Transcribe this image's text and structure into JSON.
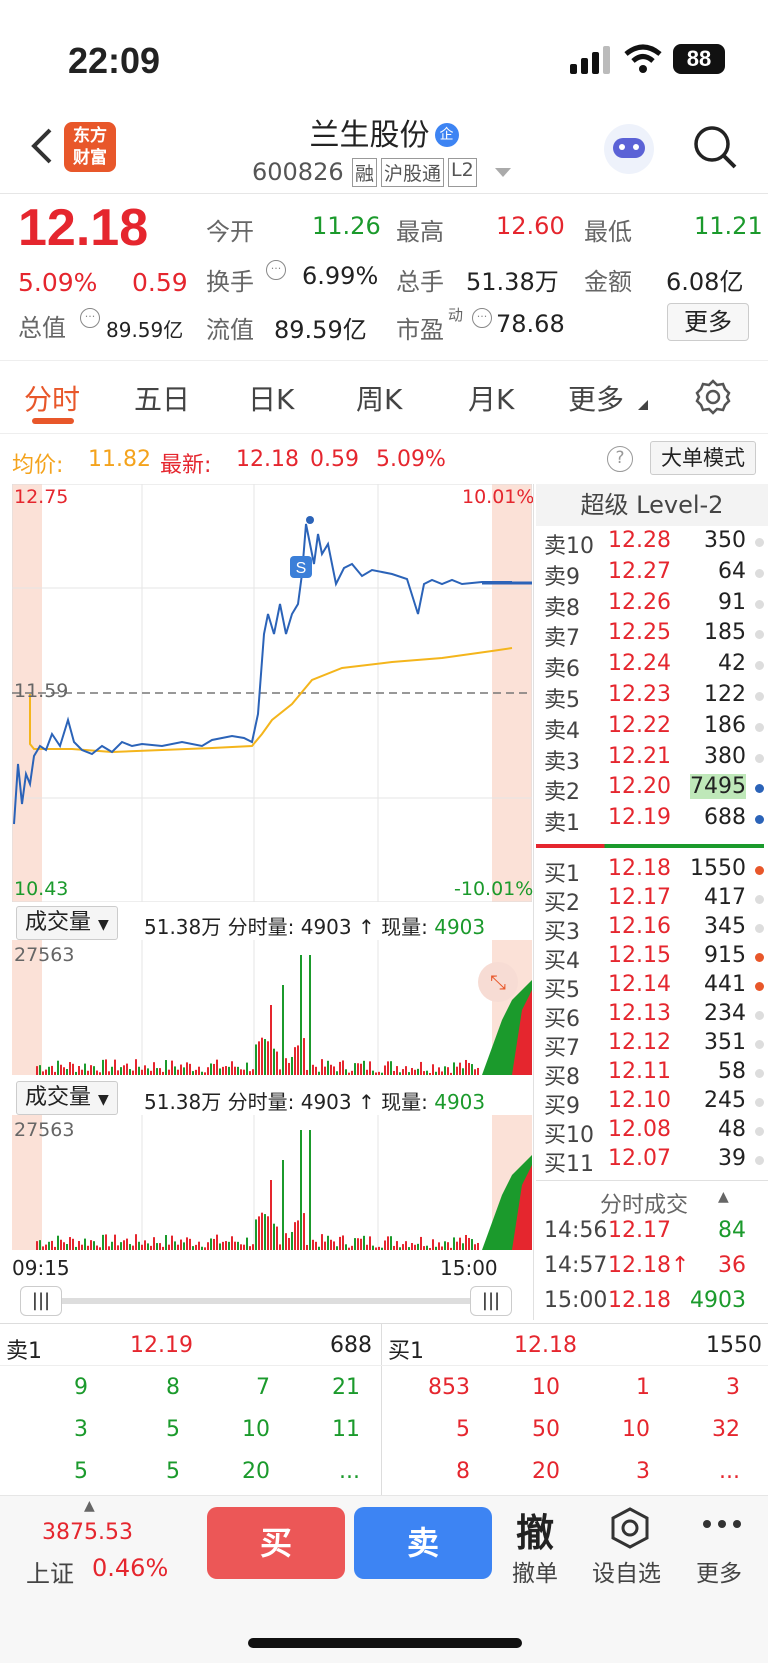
{
  "status": {
    "time": "22:09",
    "battery": "88"
  },
  "header": {
    "name": "兰生股份",
    "badge": "企",
    "code": "600826",
    "tags": [
      "融",
      "沪股通",
      "L2"
    ]
  },
  "quote": {
    "price": "12.18",
    "pct": "5.09%",
    "chg": "0.59",
    "total_label": "总值",
    "total_value": "89.59亿",
    "open_label": "今开",
    "open": "11.26",
    "high_label": "最高",
    "high": "12.60",
    "low_label": "最低",
    "low": "11.21",
    "turn_label": "换手",
    "turn": "6.99%",
    "vol_label": "总手",
    "vol": "51.38万",
    "amt_label": "金额",
    "amt": "6.08亿",
    "float_label": "流值",
    "float": "89.59亿",
    "pe_label": "市盈",
    "pe_sup": "动",
    "pe": "78.68",
    "more": "更多"
  },
  "tabs": [
    "分时",
    "五日",
    "日K",
    "周K",
    "月K",
    "更多"
  ],
  "infobar": {
    "avg_label": "均价:",
    "avg": "11.82",
    "last_label": "最新:",
    "last": "12.18",
    "chg": "0.59",
    "pct": "5.09%",
    "mode": "大单模式"
  },
  "chart": {
    "top_price": "12.75",
    "top_pct": "10.01%",
    "mid_price": "11.59",
    "bot_price": "10.43",
    "bot_pct": "-10.01%",
    "marker": "S"
  },
  "volume": {
    "selector": "成交量",
    "total": "51.38万",
    "fs_label": "分时量:",
    "fs_val": "4903",
    "arrow": "↑",
    "now_label": "现量:",
    "now_val": "4903",
    "max": "27563"
  },
  "axis": {
    "start": "09:15",
    "end": "15:00"
  },
  "level2_title": "超级 Level-2",
  "asks": [
    [
      "卖10",
      "12.28",
      "350"
    ],
    [
      "卖9",
      "12.27",
      "64"
    ],
    [
      "卖8",
      "12.26",
      "91"
    ],
    [
      "卖7",
      "12.25",
      "185"
    ],
    [
      "卖6",
      "12.24",
      "42"
    ],
    [
      "卖5",
      "12.23",
      "122"
    ],
    [
      "卖4",
      "12.22",
      "186"
    ],
    [
      "卖3",
      "12.21",
      "380"
    ],
    [
      "卖2",
      "12.20",
      "7495"
    ],
    [
      "卖1",
      "12.19",
      "688"
    ]
  ],
  "bids": [
    [
      "买1",
      "12.18",
      "1550"
    ],
    [
      "买2",
      "12.17",
      "417"
    ],
    [
      "买3",
      "12.16",
      "345"
    ],
    [
      "买4",
      "12.15",
      "915"
    ],
    [
      "买5",
      "12.14",
      "441"
    ],
    [
      "买6",
      "12.13",
      "234"
    ],
    [
      "买7",
      "12.12",
      "351"
    ],
    [
      "买8",
      "12.11",
      "58"
    ],
    [
      "买9",
      "12.10",
      "245"
    ],
    [
      "买10",
      "12.08",
      "48"
    ],
    [
      "买11",
      "12.07",
      "39"
    ]
  ],
  "ticks": {
    "title": "分时成交",
    "rows": [
      [
        "14:56",
        "12.17",
        "84"
      ],
      [
        "14:57",
        "12.18↑",
        "36"
      ],
      [
        "15:00",
        "12.18",
        "4903"
      ]
    ]
  },
  "queue": {
    "sell_label": "卖1",
    "sell_price": "12.19",
    "sell_vol": "688",
    "buy_label": "买1",
    "buy_price": "12.18",
    "buy_vol": "1550",
    "sell_rows": [
      [
        "9",
        "8",
        "7",
        "21"
      ],
      [
        "3",
        "5",
        "10",
        "11"
      ],
      [
        "5",
        "5",
        "20",
        "..."
      ]
    ],
    "buy_rows": [
      [
        "853",
        "10",
        "1",
        "3"
      ],
      [
        "5",
        "50",
        "10",
        "32"
      ],
      [
        "8",
        "20",
        "3",
        "..."
      ]
    ]
  },
  "index": {
    "value": "3875.53",
    "name": "上证",
    "pct": "0.46%"
  },
  "actions": {
    "buy": "买",
    "sell": "卖",
    "cancel_icon": "撤",
    "cancel": "撤单",
    "watch": "设自选",
    "more": "更多"
  }
}
